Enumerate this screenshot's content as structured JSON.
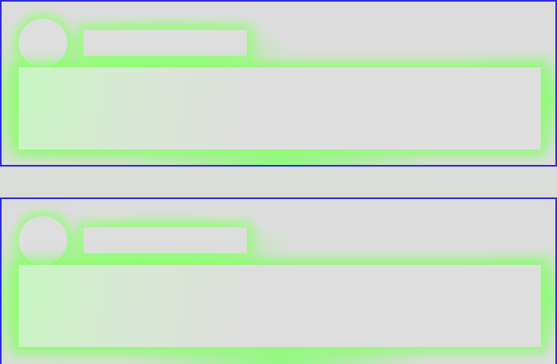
{
  "cards": [
    {
      "avatar_icon": "avatar-placeholder-icon",
      "title": "",
      "body": ""
    },
    {
      "avatar_icon": "avatar-placeholder-icon",
      "title": "",
      "body": ""
    }
  ],
  "colors": {
    "skeleton": "#dedede",
    "glow": "#96ff78",
    "border": "#2a2ee0",
    "background": "#dadcd8"
  }
}
